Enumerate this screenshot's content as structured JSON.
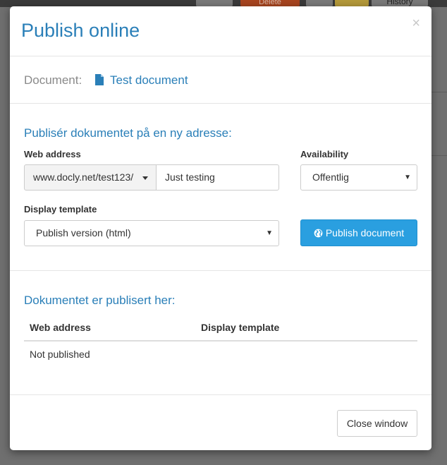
{
  "background": {
    "delete_label": "Delete",
    "history_label": "History"
  },
  "modal": {
    "title": "Publish online",
    "close_glyph": "×",
    "document": {
      "label": "Document:",
      "icon": "file-icon",
      "name": "Test document"
    },
    "publish_section": {
      "title": "Publisér dokumentet på en ny adresse:",
      "web_address_label": "Web address",
      "address_prefix": "www.docly.net/test123/",
      "address_value": "Just testing",
      "availability_label": "Availability",
      "availability_value": "Offentlig",
      "template_label": "Display template",
      "template_value": "Publish version (html)",
      "publish_button": "Publish document",
      "publish_icon": "globe-icon"
    },
    "published_section": {
      "title": "Dokumentet er publisert her:",
      "columns": [
        "Web address",
        "Display template"
      ],
      "empty_text": "Not published"
    },
    "footer": {
      "close_button": "Close window"
    }
  },
  "colors": {
    "accent": "#2a7fb8",
    "primary_button": "#2a9fe0",
    "overlay": "#6f6f6f"
  }
}
